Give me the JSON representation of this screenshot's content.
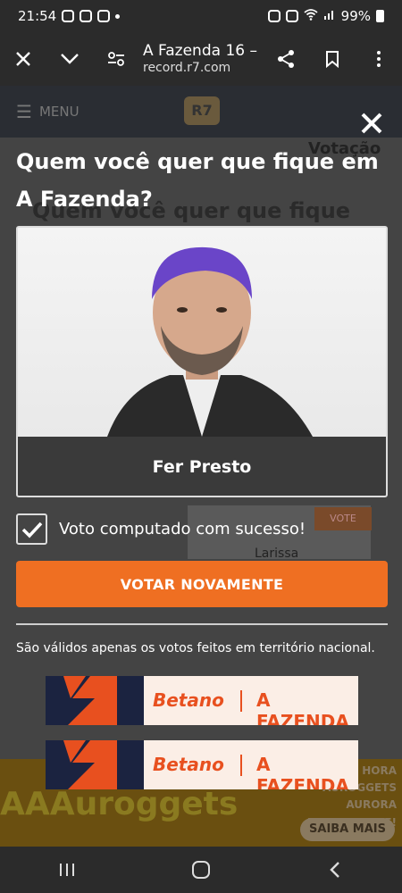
{
  "status_bar": {
    "time": "21:54",
    "battery": "99%"
  },
  "browser": {
    "close_icon": "close-icon",
    "title": "A Fazenda 16 – ...",
    "url": "record.r7.com"
  },
  "background_page": {
    "menu_label": "MENU",
    "logo": "R7",
    "right_title": "Votação",
    "title": "Quem você quer que fique",
    "vote_label": "VOTE",
    "candidate_name": "Larissa"
  },
  "modal": {
    "title": "Quem você quer que fique em A Fazenda?",
    "candidate_name": "Fer Presto",
    "success_message": "Voto computado com sucesso!",
    "vote_again_label": "VOTAR NOVAMENTE",
    "notice": "São válidos apenas os votos feitos em território nacional.",
    "sponsors": [
      {
        "brand": "Betano",
        "show": "A FAZENDA"
      },
      {
        "brand": "Betano",
        "show": "A FAZENDA"
      }
    ]
  },
  "ad": {
    "text": "AAAuroggets",
    "side_text": "R HORA AUROGGETS AURORA EXPERIMENTE!",
    "button": "SAIBA MAIS"
  },
  "colors": {
    "accent": "#ef6f22",
    "betano_orange": "#e8501f",
    "betano_navy": "#1b2340"
  }
}
